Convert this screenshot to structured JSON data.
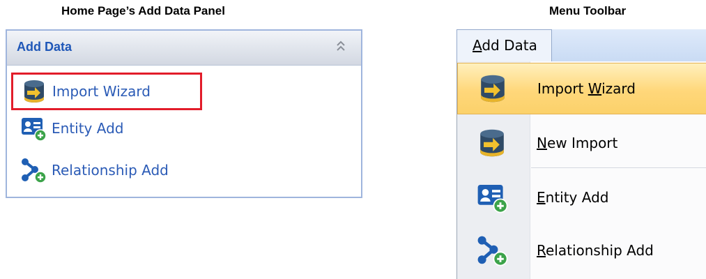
{
  "captions": {
    "left": "Home Page’s Add Data Panel",
    "right": "Menu Toolbar"
  },
  "panel": {
    "title": "Add Data",
    "collapse_icon": "double-chevron-up-icon",
    "items": [
      {
        "label": "Import Wizard",
        "icon": "import-database-icon",
        "highlighted": true,
        "highlight_color": "#e21d2a"
      },
      {
        "label": "Entity Add",
        "icon": "entity-card-add-icon"
      },
      {
        "label": "Relationship Add",
        "icon": "relationship-add-icon"
      }
    ]
  },
  "menu": {
    "tab": "Add Data",
    "items": [
      {
        "label_pre": "Import ",
        "mnemonic": "W",
        "label_post": "izard",
        "icon": "import-database-icon",
        "selected": true
      },
      {
        "label_pre": "",
        "mnemonic": "N",
        "label_post": "ew Import",
        "icon": "import-database-icon"
      },
      {
        "label_pre": "",
        "mnemonic": "E",
        "label_post": "ntity Add",
        "icon": "entity-card-add-icon"
      },
      {
        "label_pre": "",
        "mnemonic": "R",
        "label_post": "elationship Add",
        "icon": "relationship-add-icon"
      }
    ]
  },
  "colors": {
    "panel_title": "#1f57b8",
    "panel_link": "#2b5bb6",
    "menu_selected": "#ffd77a",
    "highlight_box": "#e21d2a"
  }
}
